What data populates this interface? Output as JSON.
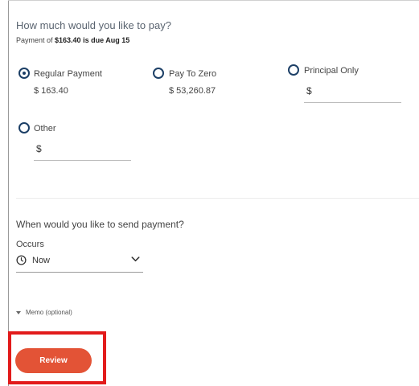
{
  "amount_section": {
    "question": "How much would you like to pay?",
    "due_prefix": "Payment of ",
    "due_amount_text": "$163.40 is due Aug 15"
  },
  "options": [
    {
      "label": "Regular Payment",
      "amount": "$ 163.40",
      "selected": true
    },
    {
      "label": "Pay To Zero",
      "amount": "$ 53,260.87",
      "selected": false
    },
    {
      "label": "Principal Only",
      "currency_symbol": "$",
      "selected": false
    },
    {
      "label": "Other",
      "currency_symbol": "$",
      "selected": false
    }
  ],
  "schedule_section": {
    "question": "When would you like to send payment?",
    "occurs_label": "Occurs",
    "occurs_value": "Now",
    "clock_icon": "clock-icon",
    "dropdown_icon": "chevron-down-icon"
  },
  "memo": {
    "label": "Memo (optional)",
    "toggle_icon": "caret-down-icon"
  },
  "actions": {
    "review_label": "Review"
  },
  "colors": {
    "radio": "#1c3f66",
    "review_button": "#e35336",
    "highlight_box": "#e21b1b"
  }
}
